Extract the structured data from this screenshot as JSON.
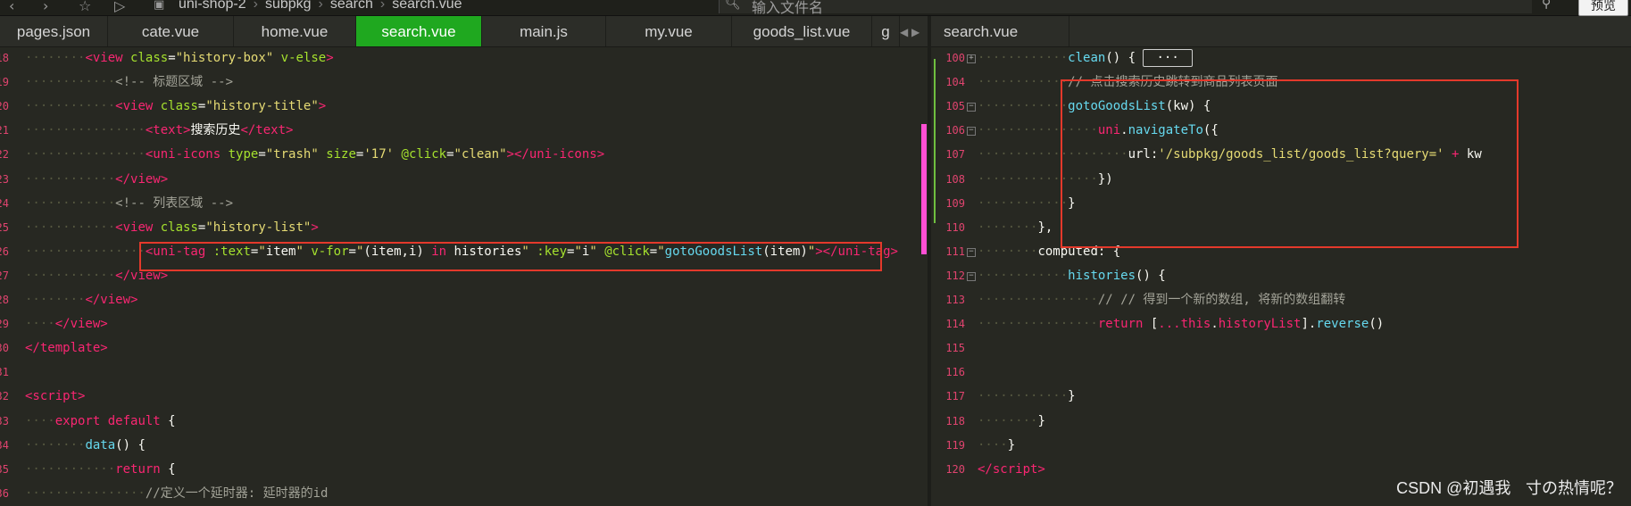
{
  "topbar": {
    "nav_back": "‹",
    "nav_forward": "›",
    "nav_star": "☆",
    "nav_run": "▷",
    "breadcrumb": [
      "uni-shop-2",
      "subpkg",
      "search",
      "search.vue"
    ],
    "file_search_placeholder": "输入文件名",
    "preview_label": "预览"
  },
  "tabs_left": [
    {
      "label": "pages.json"
    },
    {
      "label": "cate.vue"
    },
    {
      "label": "home.vue"
    },
    {
      "label": "search.vue",
      "active": true
    },
    {
      "label": "main.js"
    },
    {
      "label": "my.vue"
    },
    {
      "label": "goods_list.vue"
    },
    {
      "label": "g"
    }
  ],
  "tab_arrows": "◀ ▶",
  "tab_right": {
    "label": "search.vue"
  },
  "left_lines": [
    {
      "n": "18",
      "fold": false,
      "dots": "········",
      "html": "<span class='tg'>&lt;view</span> <span class='at'>class</span>=<span class='st'>\"history-box\"</span> <span class='at'>v-else</span><span class='tg'>&gt;</span>"
    },
    {
      "n": "19",
      "fold": false,
      "dots": "············",
      "html": "<span class='cm'>&lt;!-- 标题区域 --&gt;</span>"
    },
    {
      "n": "20",
      "fold": false,
      "dots": "············",
      "html": "<span class='tg'>&lt;view</span> <span class='at'>class</span>=<span class='st'>\"history-title\"</span><span class='tg'>&gt;</span>"
    },
    {
      "n": "21",
      "fold": false,
      "dots": "················",
      "html": "<span class='tg'>&lt;text&gt;</span>搜索历史<span class='tg'>&lt;/text&gt;</span>"
    },
    {
      "n": "22",
      "fold": false,
      "dots": "················",
      "html": "<span class='tg'>&lt;uni-icons</span> <span class='at'>type</span>=<span class='st'>\"trash\"</span> <span class='at'>size</span>=<span class='st'>'17'</span> <span class='at'>@click</span>=<span class='st'>\"clean\"</span><span class='tg'>&gt;&lt;/uni-icons&gt;</span>"
    },
    {
      "n": "23",
      "fold": false,
      "dots": "············",
      "html": "<span class='tg'>&lt;/view&gt;</span>"
    },
    {
      "n": "24",
      "fold": false,
      "dots": "············",
      "html": "<span class='cm'>&lt;!-- 列表区域 --&gt;</span>"
    },
    {
      "n": "25",
      "fold": false,
      "dots": "············",
      "html": "<span class='tg'>&lt;view</span> <span class='at'>class</span>=<span class='st'>\"history-list\"</span><span class='tg'>&gt;</span>"
    },
    {
      "n": "26",
      "fold": false,
      "dots": "················",
      "html": "<span class='tg'>&lt;uni-tag</span> <span class='at'>:text</span>=<span class='st'>\"</span>item<span class='st'>\"</span> <span class='at'>v-for</span>=<span class='st'>\"</span>(item,i) <span class='kw'>in</span> histories<span class='st'>\"</span> <span class='at'>:key</span>=<span class='st'>\"</span>i<span class='st'>\"</span> <span class='at'>@click</span>=<span class='st'>\"</span><span class='fn'>gotoGoodsList</span>(item)<span class='st'>\"</span><span class='tg'>&gt;&lt;/uni-tag&gt;</span>"
    },
    {
      "n": "27",
      "fold": false,
      "dots": "············",
      "html": "<span class='tg'>&lt;/view&gt;</span>"
    },
    {
      "n": "28",
      "fold": false,
      "dots": "········",
      "html": "<span class='tg'>&lt;/view&gt;</span>"
    },
    {
      "n": "29",
      "fold": false,
      "dots": "····",
      "html": "<span class='tg'>&lt;/view&gt;</span>"
    },
    {
      "n": "30",
      "fold": false,
      "dots": "",
      "html": "<span class='tg'>&lt;/template&gt;</span>"
    },
    {
      "n": "31",
      "fold": false,
      "dots": "",
      "html": ""
    },
    {
      "n": "32",
      "fold": false,
      "dots": "",
      "html": "<span class='tg'>&lt;script&gt;</span>"
    },
    {
      "n": "33",
      "fold": false,
      "dots": "····",
      "html": "<span class='kw'>export</span> <span class='kw'>default</span> {"
    },
    {
      "n": "34",
      "fold": false,
      "dots": "········",
      "html": "<span class='fn'>data</span>() {"
    },
    {
      "n": "35",
      "fold": false,
      "dots": "············",
      "html": "<span class='kw'>return</span> {"
    },
    {
      "n": "36",
      "fold": false,
      "dots": "················",
      "html": "<span class='cm'>//定义一个延时器: 延时器的id</span>"
    }
  ],
  "right_lines": [
    {
      "n": "100",
      "fold": "plus",
      "dots": "············",
      "html": "<span class='fn'>clean</span>() { <span class='collapsed'>···</span>"
    },
    {
      "n": "104",
      "fold": "",
      "dots": "············",
      "html": "<span class='cm'>// 点击搜索历史跳转到商品列表页面</span>"
    },
    {
      "n": "105",
      "fold": "minus",
      "dots": "············",
      "html": "<span class='fn'>gotoGoodsList</span>(kw) {"
    },
    {
      "n": "106",
      "fold": "minus",
      "dots": "················",
      "html": "<span class='kw'>uni</span>.<span class='fn'>navigateTo</span>({"
    },
    {
      "n": "107",
      "fold": "",
      "dots": "····················",
      "html": "url:<span class='st'>'/subpkg/goods_list/goods_list?query='</span> <span class='kw'>+</span> kw"
    },
    {
      "n": "108",
      "fold": "",
      "dots": "················",
      "html": "})"
    },
    {
      "n": "109",
      "fold": "",
      "dots": "············",
      "html": "}"
    },
    {
      "n": "110",
      "fold": "",
      "dots": "········",
      "html": "},"
    },
    {
      "n": "111",
      "fold": "minus",
      "dots": "········",
      "html": "computed: {"
    },
    {
      "n": "112",
      "fold": "minus",
      "dots": "············",
      "html": "<span class='fn'>histories</span>() {"
    },
    {
      "n": "113",
      "fold": "",
      "dots": "················",
      "html": "<span class='cm'>// // 得到一个新的数组, 将新的数组翻转</span>"
    },
    {
      "n": "114",
      "fold": "",
      "dots": "················",
      "html": "<span class='kw'>return</span> [<span class='kw'>...</span><span class='kw'>this</span>.<span class='kw'>historyList</span>].<span class='fn'>reverse</span>()"
    },
    {
      "n": "115",
      "fold": "",
      "dots": "",
      "html": ""
    },
    {
      "n": "116",
      "fold": "",
      "dots": "",
      "html": ""
    },
    {
      "n": "117",
      "fold": "",
      "dots": "············",
      "html": "}"
    },
    {
      "n": "118",
      "fold": "",
      "dots": "········",
      "html": "}"
    },
    {
      "n": "119",
      "fold": "",
      "dots": "····",
      "html": "}"
    },
    {
      "n": "120",
      "fold": "",
      "dots": "",
      "html": "<span class='tg'>&lt;/script&gt;</span>"
    }
  ],
  "watermark": "CSDN @初遇我ㅤ寸の热情呢？",
  "colors": {
    "accent_tab": "#1fa81f",
    "highlight_box": "#e4392b",
    "line_number": "#e0446f"
  }
}
